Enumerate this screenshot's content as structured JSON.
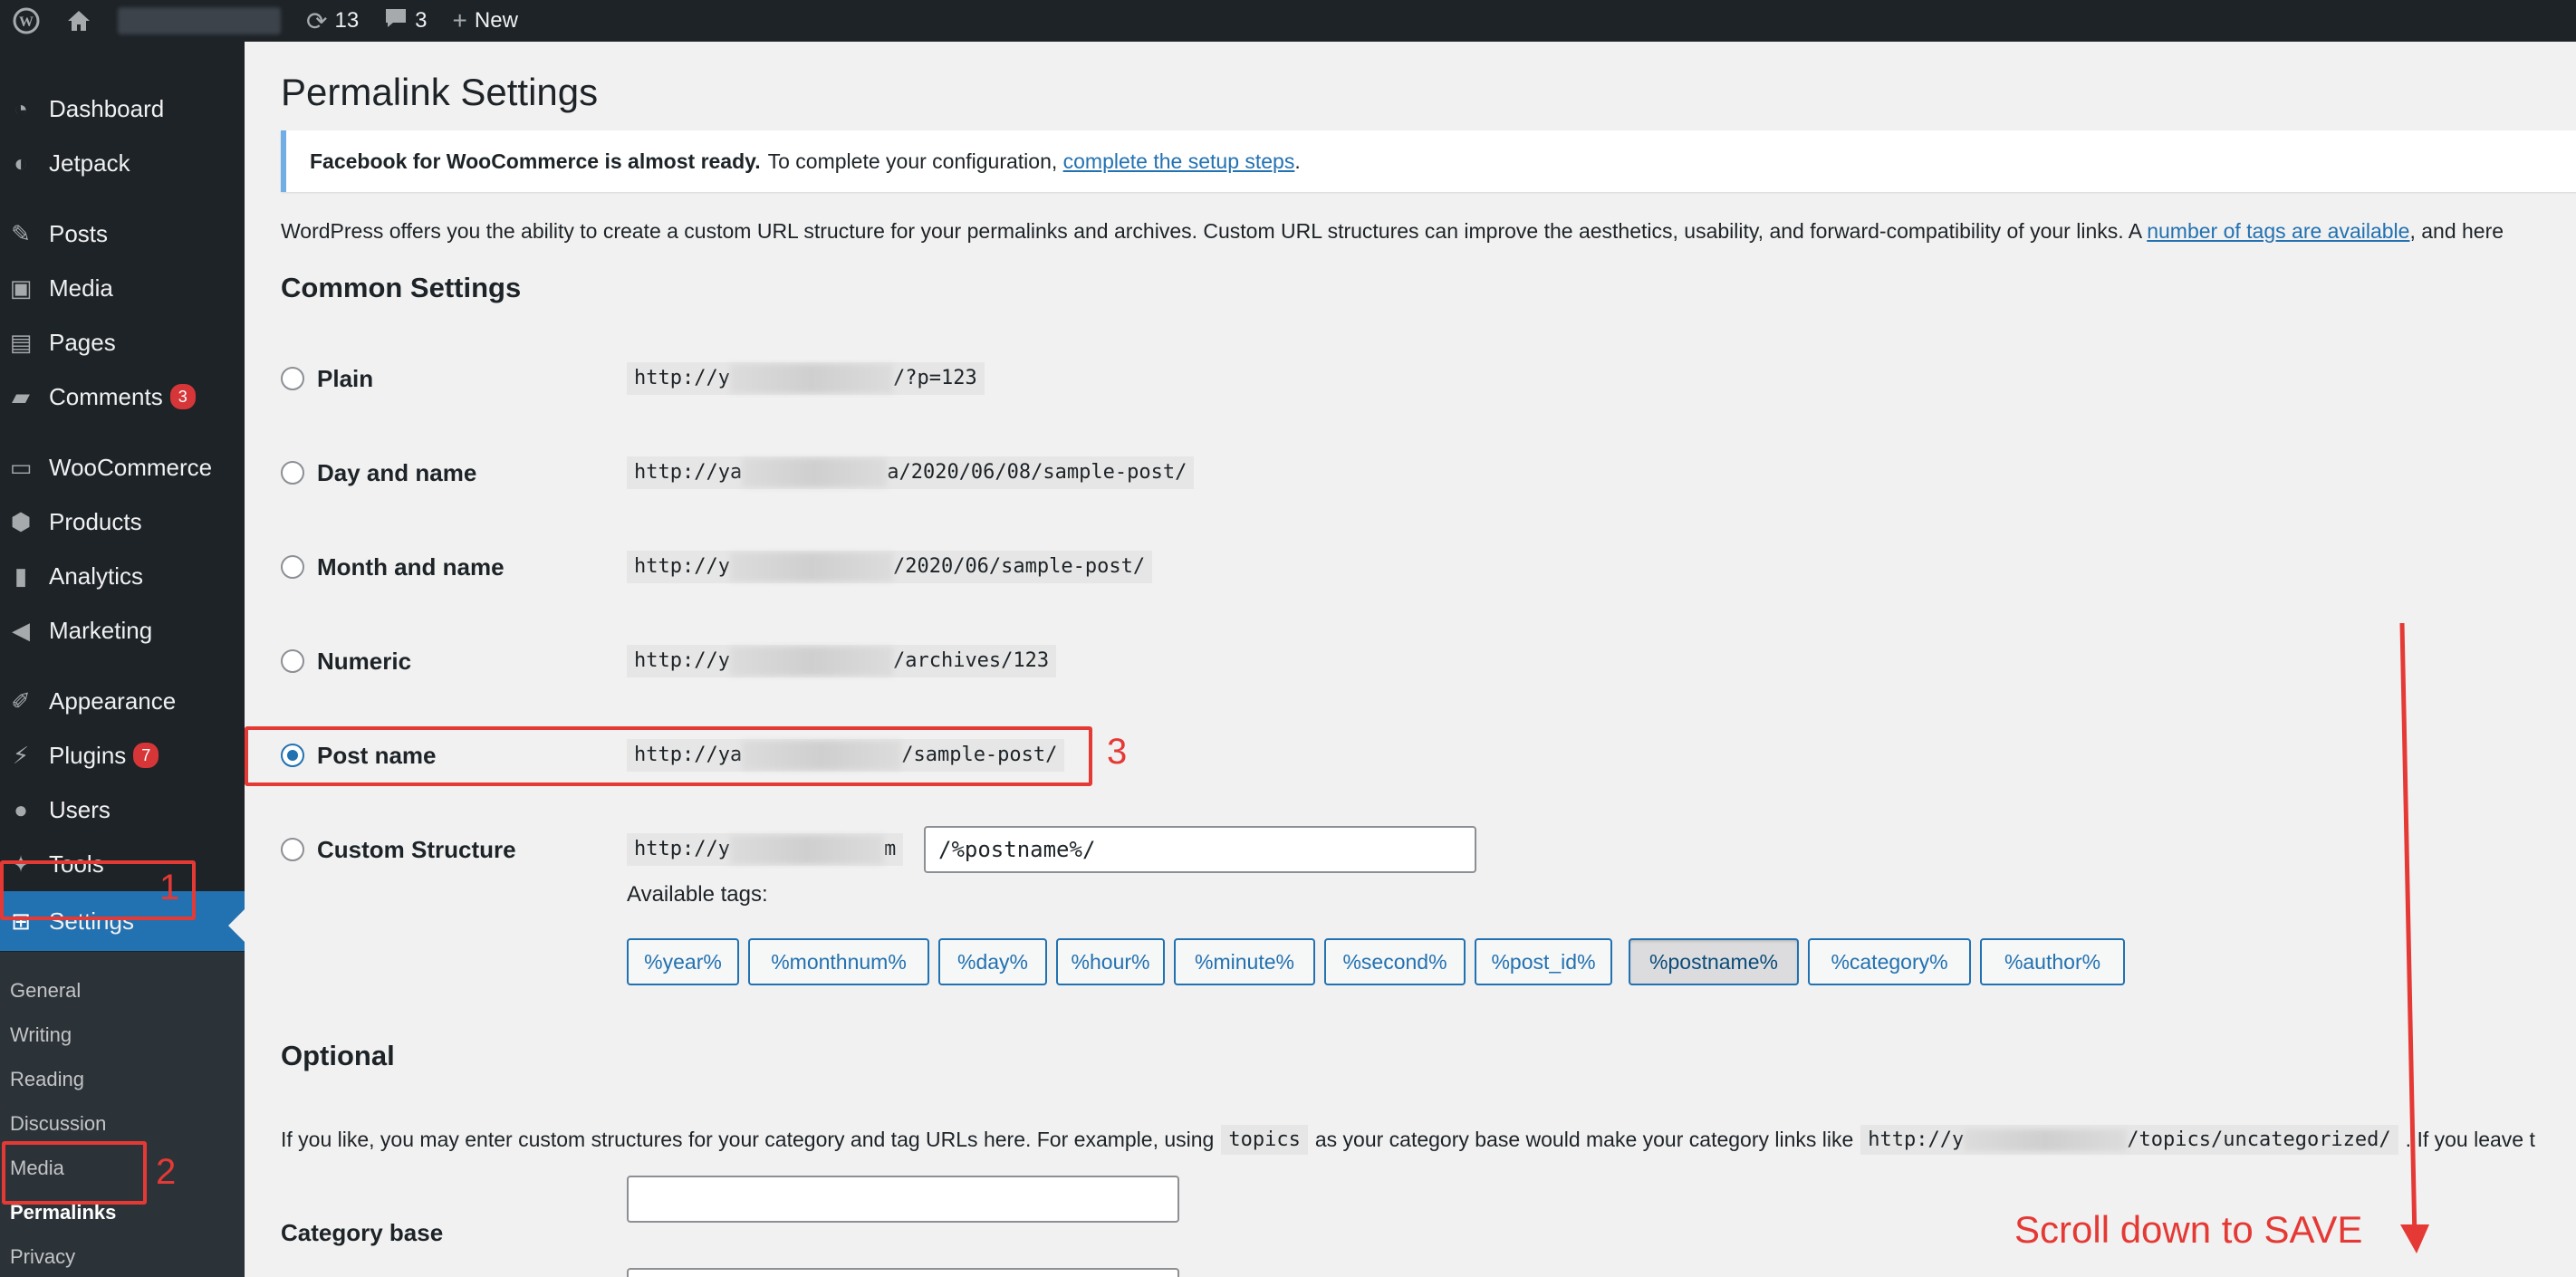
{
  "adminbar": {
    "updates_count": "13",
    "comments_count": "3",
    "new_label": "New"
  },
  "sidebar": {
    "items": [
      {
        "label": "Dashboard",
        "icon": "dashboard-icon"
      },
      {
        "label": "Jetpack",
        "icon": "jetpack-icon"
      },
      {
        "label": "Posts",
        "icon": "pin-icon"
      },
      {
        "label": "Media",
        "icon": "media-icon"
      },
      {
        "label": "Pages",
        "icon": "pages-icon"
      },
      {
        "label": "Comments",
        "icon": "comment-icon",
        "count": "3"
      },
      {
        "label": "WooCommerce",
        "icon": "woocommerce-icon"
      },
      {
        "label": "Products",
        "icon": "box-icon"
      },
      {
        "label": "Analytics",
        "icon": "bar-chart-icon"
      },
      {
        "label": "Marketing",
        "icon": "megaphone-icon"
      },
      {
        "label": "Appearance",
        "icon": "brush-icon"
      },
      {
        "label": "Plugins",
        "icon": "plug-icon",
        "count": "7"
      },
      {
        "label": "Users",
        "icon": "user-icon"
      },
      {
        "label": "Tools",
        "icon": "wrench-icon"
      },
      {
        "label": "Settings",
        "icon": "settings-icon"
      }
    ],
    "submenu": [
      "General",
      "Writing",
      "Reading",
      "Discussion",
      "Media",
      "Permalinks",
      "Privacy"
    ]
  },
  "page": {
    "title": "Permalink Settings",
    "notice_bold": "Facebook for WooCommerce is almost ready.",
    "notice_text": "To complete your configuration,",
    "notice_link": "complete the setup steps",
    "notice_end": ".",
    "intro_text": "WordPress offers you the ability to create a custom URL structure for your permalinks and archives. Custom URL structures can improve the aesthetics, usability, and forward-compatibility of your links. A",
    "intro_link": "number of tags are available",
    "intro_end": ", and here",
    "common_heading": "Common Settings",
    "options": [
      {
        "label": "Plain",
        "url_start": "http://y",
        "url_end": "/?p=123",
        "checked": false
      },
      {
        "label": "Day and name",
        "url_start": "http://ya",
        "url_end": "a/2020/06/08/sample-post/",
        "checked": false
      },
      {
        "label": "Month and name",
        "url_start": "http://y",
        "url_end": "/2020/06/sample-post/",
        "checked": false
      },
      {
        "label": "Numeric",
        "url_start": "http://y",
        "url_end": "/archives/123",
        "checked": false
      },
      {
        "label": "Post name",
        "url_start": "http://ya",
        "url_end": "/sample-post/",
        "checked": true
      },
      {
        "label": "Custom Structure",
        "url_start": "http://y",
        "url_end": "m",
        "checked": false
      }
    ],
    "custom_value": "/%postname%/",
    "available_tags_label": "Available tags:",
    "tags": [
      "%year%",
      "%monthnum%",
      "%day%",
      "%hour%",
      "%minute%",
      "%second%",
      "%post_id%",
      "%postname%",
      "%category%",
      "%author%"
    ],
    "active_tag": "%postname%",
    "optional_heading": "Optional",
    "optional_text_1": "If you like, you may enter custom structures for your category and tag URLs here. For example, using",
    "optional_code_1": "topics",
    "optional_text_2": "as your category base would make your category links like",
    "optional_code_2_start": "http://y",
    "optional_code_2_end": "/topics/uncategorized/",
    "optional_text_3": ". If you leave t",
    "category_base_label": "Category base",
    "category_base_value": ""
  },
  "annotations": {
    "num1": "1",
    "num2": "2",
    "num3": "3",
    "scroll_text": "Scroll down to SAVE",
    "color": "#e53935"
  }
}
